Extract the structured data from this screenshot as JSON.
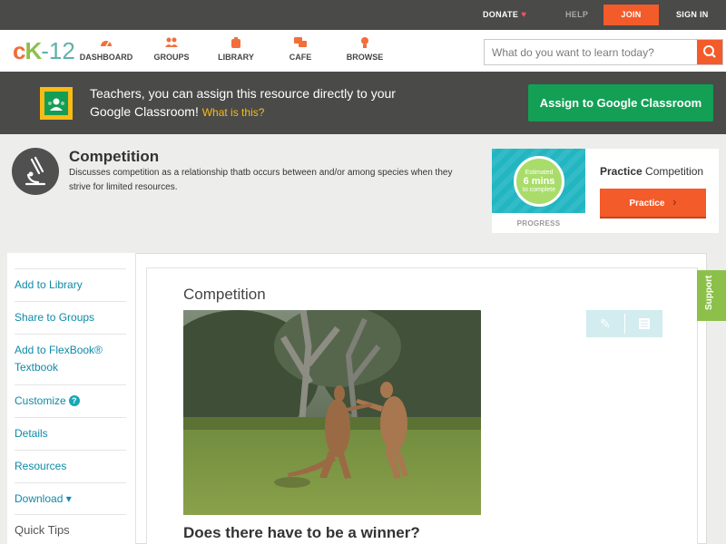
{
  "topbar": {
    "donate": "DONATE",
    "help": "HELP",
    "join": "JOIN",
    "sign_in": "SIGN IN"
  },
  "nav": {
    "logo": {
      "c": "c",
      "k": "K",
      "num": "-12"
    },
    "items": [
      {
        "label": "DASHBOARD",
        "icon": "dashboard-icon"
      },
      {
        "label": "GROUPS",
        "icon": "groups-icon"
      },
      {
        "label": "LIBRARY",
        "icon": "library-icon"
      },
      {
        "label": "CAFE",
        "icon": "cafe-icon"
      },
      {
        "label": "BROWSE",
        "icon": "browse-icon"
      }
    ],
    "search_placeholder": "What do you want to learn today?"
  },
  "banner": {
    "text": "Teachers, you can assign this resource directly to your Google Classroom!",
    "what_link": "What is this?",
    "button": "Assign to Google Classroom"
  },
  "header": {
    "title": "Competition",
    "description": "Discusses competition as a relationship thatb occurs between and/or among species when they strive for limited resources."
  },
  "practice": {
    "estimated_top": "Estimated",
    "estimated_value": "6 mins",
    "estimated_bottom": "to complete",
    "progress": "PROGRESS",
    "label_bold": "Practice",
    "label_rest": "Competition",
    "button": "Practice"
  },
  "sidebar": {
    "items": [
      {
        "label": "Add to Library"
      },
      {
        "label": "Share to Groups"
      },
      {
        "label": "Add to FlexBook® Textbook"
      },
      {
        "label": "Customize"
      },
      {
        "label": "Details"
      },
      {
        "label": "Resources"
      },
      {
        "label": "Download ▾"
      }
    ],
    "quick_tips": "Quick Tips"
  },
  "content": {
    "title": "Competition",
    "question": "Does there have to be a winner?"
  },
  "support": "Support",
  "colors": {
    "accent": "#f35b2a",
    "google_green": "#13a055",
    "link": "#0e8aa8",
    "support_green": "#8cc04b"
  }
}
